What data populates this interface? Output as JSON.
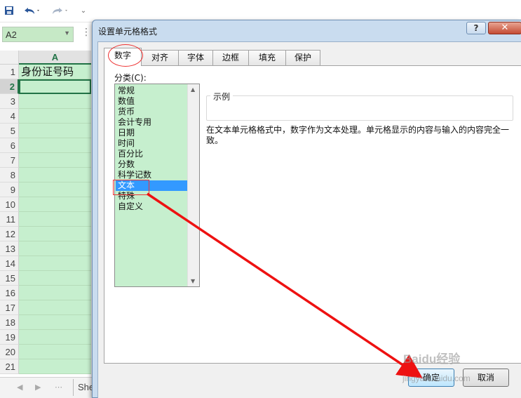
{
  "excel": {
    "name_box": "A2",
    "column_header": "A",
    "rows": [
      "1",
      "2",
      "3",
      "4",
      "5",
      "6",
      "7",
      "8",
      "9",
      "10",
      "11",
      "12",
      "13",
      "14",
      "15",
      "16",
      "17",
      "18",
      "19",
      "20",
      "21"
    ],
    "a1_value": "身份证号码",
    "sheet_tab": "She",
    "selected_row": "2"
  },
  "dialog": {
    "title": "设置单元格格式",
    "help": "?",
    "close": "✕",
    "tabs": [
      "数字",
      "对齐",
      "字体",
      "边框",
      "填充",
      "保护"
    ],
    "active_tab": "数字",
    "category_label": "分类(C):",
    "categories": [
      "常规",
      "数值",
      "货币",
      "会计专用",
      "日期",
      "时间",
      "百分比",
      "分数",
      "科学记数",
      "文本",
      "特殊",
      "自定义"
    ],
    "selected_category": "文本",
    "sample_label": "示例",
    "description": "在文本单元格格式中，数字作为文本处理。单元格显示的内容与输入的内容完全一致。",
    "ok": "确定",
    "cancel": "取消"
  },
  "watermark": {
    "brand": "Baidu经验",
    "url": "jingyan.baidu.com"
  },
  "colors": {
    "excel_green": "#217346",
    "selection_fill": "#c6efce",
    "annotation_red": "#ee2222",
    "selected_item": "#3399ff"
  }
}
